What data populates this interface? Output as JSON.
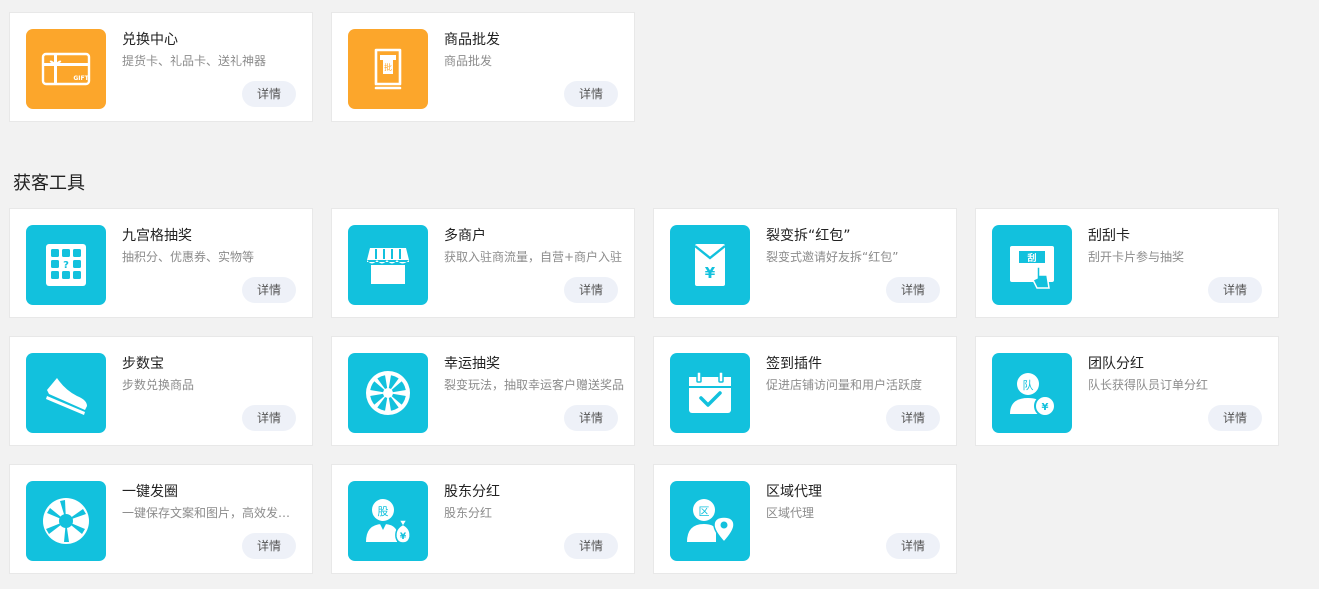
{
  "top_cards": [
    {
      "title": "兑换中心",
      "desc": "提货卡、礼品卡、送礼神器",
      "button": "详情",
      "icon": "gift-card-icon",
      "color": "#fca62b",
      "gift_text": "GIFT"
    },
    {
      "title": "商品批发",
      "desc": "商品批发",
      "button": "详情",
      "icon": "wholesale-icon",
      "color": "#fca62b",
      "glyph": "批"
    }
  ],
  "section": {
    "title": "获客工具"
  },
  "tools": [
    {
      "title": "九宫格抽奖",
      "desc": "抽积分、优惠券、实物等",
      "button": "详情",
      "icon": "nine-grid-icon",
      "glyph": "?"
    },
    {
      "title": "多商户",
      "desc": "获取入驻商流量，自营+商户入驻",
      "button": "详情",
      "icon": "storefront-icon"
    },
    {
      "title": "裂变拆“红包”",
      "desc": "裂变式邀请好友拆“红包”",
      "button": "详情",
      "icon": "red-envelope-icon",
      "glyph": "¥"
    },
    {
      "title": "刮刮卡",
      "desc": "刮开卡片参与抽奖",
      "button": "详情",
      "icon": "scratch-card-icon",
      "glyph": "刮"
    },
    {
      "title": "步数宝",
      "desc": "步数兑换商品",
      "button": "详情",
      "icon": "sneaker-icon"
    },
    {
      "title": "幸运抽奖",
      "desc": "裂变玩法，抽取幸运客户赠送奖品",
      "button": "详情",
      "icon": "lucky-wheel-icon"
    },
    {
      "title": "签到插件",
      "desc": "促进店铺访问量和用户活跃度",
      "button": "详情",
      "icon": "calendar-check-icon"
    },
    {
      "title": "团队分红",
      "desc": "队长获得队员订单分红",
      "button": "详情",
      "icon": "team-bonus-icon",
      "glyph": "队",
      "glyph2": "¥"
    },
    {
      "title": "一键发圈",
      "desc": "一键保存文案和图片，高效发朋友圈",
      "button": "详情",
      "icon": "shutter-icon"
    },
    {
      "title": "股东分红",
      "desc": "股东分红",
      "button": "详情",
      "icon": "shareholder-icon",
      "glyph": "股",
      "glyph2": "¥"
    },
    {
      "title": "区域代理",
      "desc": "区域代理",
      "button": "详情",
      "icon": "region-agent-icon",
      "glyph": "区"
    }
  ],
  "colors": {
    "orange": "#fca62b",
    "cyan": "#12c1dd",
    "background": "#f2f2f2"
  }
}
